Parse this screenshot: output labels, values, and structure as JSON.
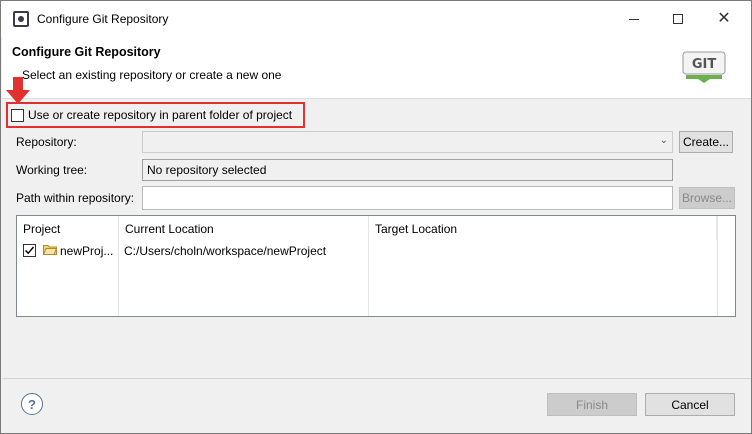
{
  "window": {
    "title": "Configure Git Repository",
    "controls": {
      "minimize": "minimize",
      "maximize": "maximize",
      "close": "✕"
    }
  },
  "banner": {
    "title": "Configure Git Repository",
    "message": "Select an existing repository or create a new one",
    "logo_text": "GIT"
  },
  "options": {
    "use_parent_label": "Use or create repository in parent folder of project",
    "use_parent_checked": false
  },
  "form": {
    "repository_label": "Repository:",
    "repository_value": "",
    "create_button": "Create...",
    "working_tree_label": "Working tree:",
    "working_tree_value": "No repository selected",
    "path_label": "Path within repository:",
    "path_value": "",
    "browse_button": "Browse..."
  },
  "table": {
    "columns": [
      "Project",
      "Current Location",
      "Target Location"
    ],
    "rows": [
      {
        "checked": true,
        "project": "newProj...",
        "current": "C:/Users/choln/workspace/newProject",
        "target": ""
      }
    ]
  },
  "footer": {
    "help": "?",
    "finish_button": "Finish",
    "cancel_button": "Cancel"
  },
  "colors": {
    "highlight": "#e03030",
    "git_logo_green": "#6ab04c"
  }
}
